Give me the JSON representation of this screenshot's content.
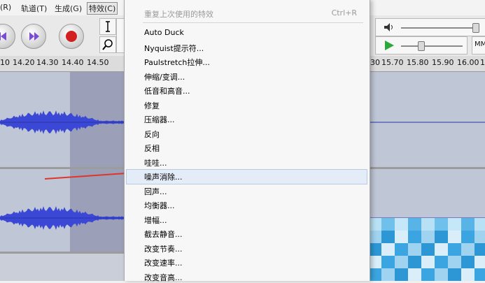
{
  "menubar": {
    "items": [
      "(R)",
      "轨道(T)",
      "生成(G)",
      "特效(C)"
    ]
  },
  "ruler": {
    "left_ticks": [
      "10",
      "14.20",
      "14.30",
      "14.40",
      "14.50"
    ],
    "right_ticks": [
      "30",
      "15.70",
      "15.80",
      "15.90",
      "16.00",
      "1"
    ]
  },
  "toolbar": {
    "meter_label": "MM"
  },
  "effects_menu": {
    "repeat_last": "重复上次使用的特效",
    "repeat_last_shortcut": "Ctrl+R",
    "items": [
      "Auto Duck",
      "Nyquist提示符...",
      "Paulstretch拉伸...",
      "伸缩/变调...",
      "低音和高音...",
      "修复",
      "压缩器...",
      "反向",
      "反相",
      "哇哇...",
      "噪声消除...",
      "回声...",
      "均衡器...",
      "增幅...",
      "截去静音...",
      "改变节奏...",
      "改变速率...",
      "改变音高..."
    ],
    "highlighted_index": 10
  },
  "colors": {
    "waveform": "#3b48d6",
    "track_bg": "#bfc6d6",
    "selection": "#9b9fb7",
    "arrow": "#e0352b",
    "record": "#d22020"
  }
}
